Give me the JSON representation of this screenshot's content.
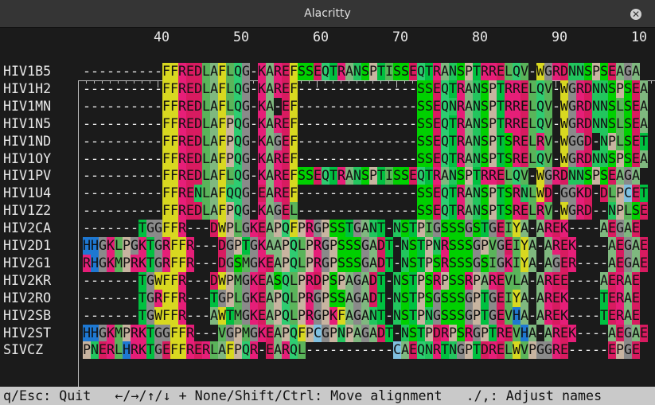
{
  "window": {
    "title": "Alacritty"
  },
  "ruler": {
    "labels": [
      "40",
      "50",
      "60",
      "70",
      "80",
      "90",
      "10"
    ],
    "first_label_column": 40
  },
  "alignment": {
    "first_column": 30,
    "names": [
      "HIV1B5",
      "HIV1H2",
      "HIV1MN",
      "HIV1N5",
      "HIV1ND",
      "HIV1OY",
      "HIV1PV",
      "HIV1U4",
      "HIV1Z2",
      "HIV2CA",
      "HIV2D1",
      "HIV2G1",
      "HIV2KR",
      "HIV2RO",
      "HIV2SB",
      "HIV2ST",
      "SIVCZ"
    ],
    "sequences": [
      "----------FFREDLAFLQG-KAREFSSEQTRANSPTISSEQTRANSPTRRELQV-WGRDNNSPSEAGA",
      "----------FFREDLAFLQG-KAREF---------------SSEQTRANSPTRRELQV-WGRDNNSPSEAGA",
      "----------FFREDLAFLQG-KA-EF---------------SSEQNRANSPTRRELQV-WGRDNNSLSEAGA",
      "----------FFREDLAFPQG-KAREF---------------SSEQTRANSPTRRELQV-WGRDNNSLSEAGA",
      "----------FFREDLAFPQG-KAGEF---------------SSEQTRANSPTSRELRV-WGGD-NPLSETGA",
      "----------FFREDLAFPQG-KAREF---------------SSEQTRANSPTSRELQV-WGRDNNSPSEAGA",
      "----------FFREDLAFLQG-KAREFSSEQTRANSPTISSEQTRANSPTRRELQV-WGRDNNSPSEAGA",
      "----------FFRENLAFQQG-EAREF---------------SSEQTRANSPTSRNLWD-GGKD-DLPCETGA",
      "----------FFREDLAFPQG-KAGEL---------------SSEQTRANSPTSRELRV-WGRD--NPLSETGA",
      "-------TGGFFR---DWPLGKEAPQFPRGPSSTGANT-NSTPIGSSSGSTGEIYA-AREK----AEGAE",
      "HHGKLPGKTGRFFR---DGPTGKAAPQLPRGPSSSGADT-NSTPNRSSSGPVGEIYA-AREK----AEGAE",
      "RHGKMPRKTGRFFR---DGSMGKEAPQLPRGPSSSGADT-NSTPSRSSSGSIGKIYA-AGER----AEGAE",
      "-------TGWFFR---DWPMGKEASQLPRDPSPAGADT-NSTPSRPSSRPAREVLA-AREE----AERAE",
      "-------TGRFFR---TGPLGKEAPQLPRGPSSAGADT-NSTPSGSSSGPTGEIYA-AREK----TERAE",
      "-------TGWFFR---AWTMGKEAPQLPRGPKFAGANT-NSTPNGSSSGPTGEVHA-AREK----TERAE",
      "HHGKMPRKTGGFFR---VGPMGKEAPQFPCGPNPAGADT-NSTPDRPSRGPTREVHA-AREK----AEGAE",
      "PNERLHRKTGEFFRERLAFPQR-EARQL-----------CAEQNRTNGPTDRELWVPGGRE-----EPGE"
    ]
  },
  "status_bar": {
    "text": "q/Esc: Quit   ←/→/↑/↓ + None/Shift/Ctrl: Move alignment   ./,: Adjust names"
  },
  "colors": {
    "title_bar": "#353535",
    "background": "#1b1b1b",
    "status_bar": "#c9c9c9",
    "residue_palette": {
      "F": "#d8d820",
      "W": "#d8d820",
      "Y": "#d8d820",
      "R": "#e61e78",
      "K": "#e61e78",
      "H": "#1e78d2",
      "E": "#d81b60",
      "D": "#d81b60",
      "L": "#5ab45a",
      "I": "#5ab45a",
      "V": "#5ab45a",
      "M": "#5ab45a",
      "A": "#7fb87f",
      "Q": "#2ecc71",
      "N": "#22c55e",
      "S": "#00d000",
      "T": "#00c040",
      "G": "#8a8a8a",
      "P": "#c8b4a0",
      "C": "#80c0e0",
      "-": "#1b1b1b"
    }
  }
}
